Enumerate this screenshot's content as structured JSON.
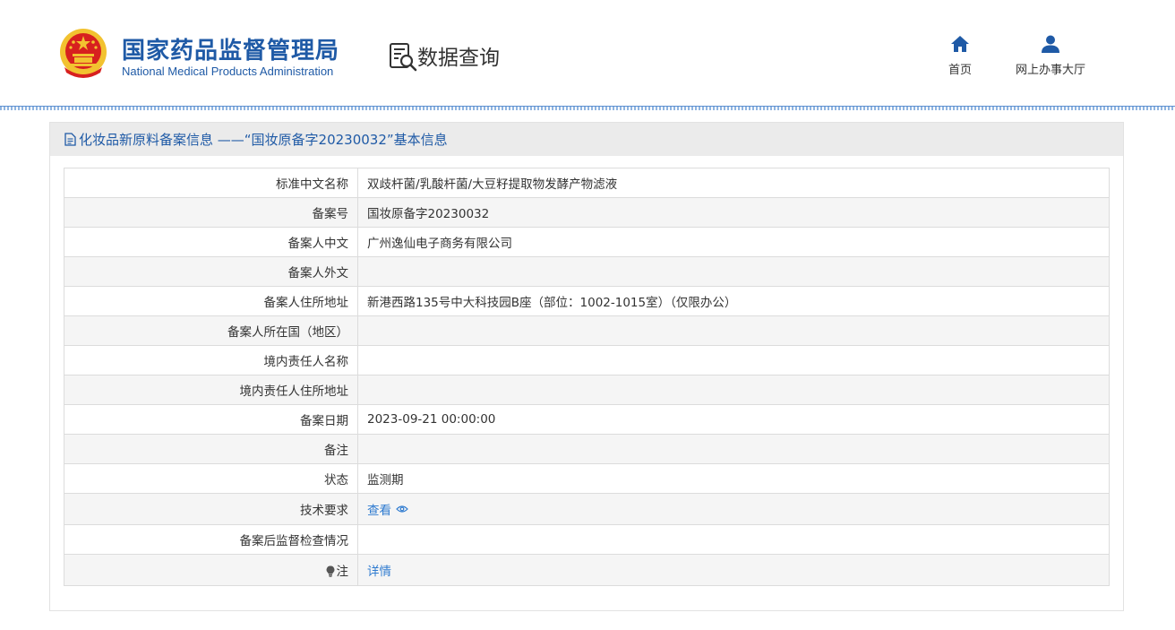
{
  "header": {
    "org_name_cn": "国家药品监督管理局",
    "org_name_en": "National Medical Products Administration",
    "section_title": "数据查询",
    "nav": [
      {
        "label": "首页",
        "icon": "home-icon"
      },
      {
        "label": "网上办事大厅",
        "icon": "user-icon"
      }
    ]
  },
  "panel": {
    "title": "化妆品新原料备案信息 ——“国妆原备字20230032”基本信息",
    "title_icon": "document-icon"
  },
  "rows": [
    {
      "label": "标准中文名称",
      "value": "双歧杆菌/乳酸杆菌/大豆籽提取物发酵产物滤液"
    },
    {
      "label": "备案号",
      "value": "国妆原备字20230032"
    },
    {
      "label": "备案人中文",
      "value": "广州逸仙电子商务有限公司"
    },
    {
      "label": "备案人外文",
      "value": ""
    },
    {
      "label": "备案人住所地址",
      "value": "新港西路135号中大科技园B座（部位：1002-1015室）（仅限办公）"
    },
    {
      "label": "备案人所在国（地区）",
      "value": ""
    },
    {
      "label": "境内责任人名称",
      "value": ""
    },
    {
      "label": "境内责任人住所地址",
      "value": ""
    },
    {
      "label": "备案日期",
      "value": "2023-09-21 00:00:00"
    },
    {
      "label": "备注",
      "value": ""
    },
    {
      "label": "状态",
      "value": "监测期"
    },
    {
      "label": "技术要求",
      "value": "",
      "link": "查看"
    },
    {
      "label": "备案后监督检查情况",
      "value": ""
    },
    {
      "label": "注",
      "value": "",
      "link": "详情"
    }
  ],
  "colors": {
    "brand_blue": "#1f5aa6",
    "link_blue": "#2f7bd0",
    "emblem_red": "#d7201f",
    "emblem_gold": "#f2c230"
  }
}
